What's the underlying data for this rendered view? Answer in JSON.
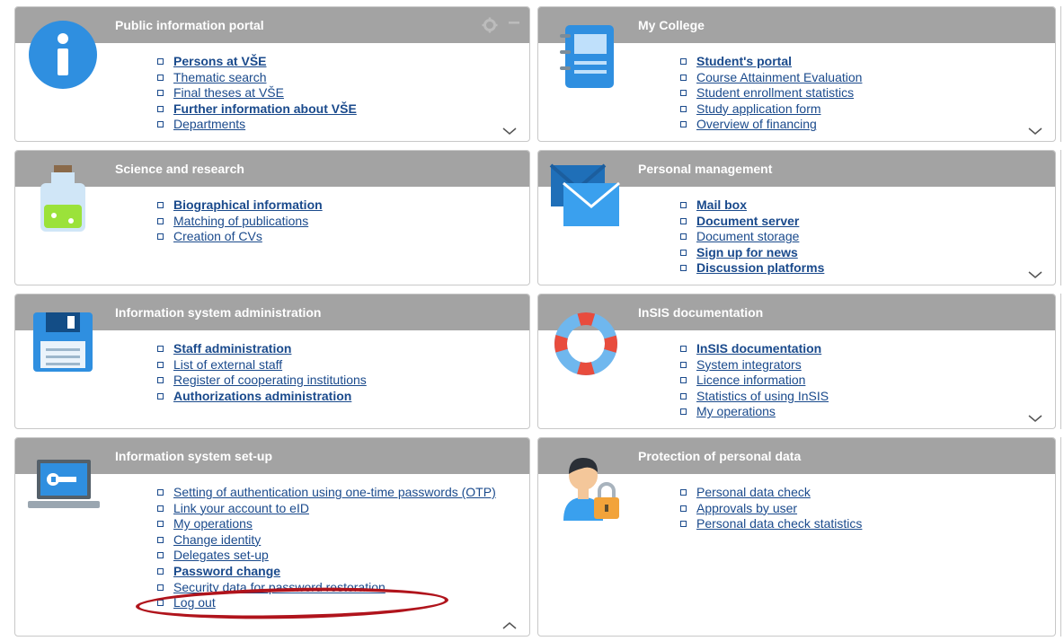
{
  "colors": {
    "header": "#a3a3a3",
    "link": "#1a4a8c",
    "highlight": "#b0141c"
  },
  "tiles": [
    {
      "title": "Public information portal",
      "icon": "info-icon",
      "toggle": "chevron-down-icon",
      "links": [
        {
          "label": "Persons at VŠE",
          "bold": true
        },
        {
          "label": "Thematic search",
          "bold": false
        },
        {
          "label": "Final theses at VŠE",
          "bold": false
        },
        {
          "label": "Further information about VŠE",
          "bold": true
        },
        {
          "label": "Departments",
          "bold": false
        }
      ]
    },
    {
      "title": "My College",
      "icon": "notebook-icon",
      "toggle": "chevron-down-icon",
      "links": [
        {
          "label": "Student's portal",
          "bold": true
        },
        {
          "label": "Course Attainment Evaluation",
          "bold": false
        },
        {
          "label": "Student enrollment statistics",
          "bold": false
        },
        {
          "label": "Study application form",
          "bold": false
        },
        {
          "label": "Overview of financing",
          "bold": false
        }
      ]
    },
    {
      "title": "Science and research",
      "icon": "flask-icon",
      "toggle": null,
      "links": [
        {
          "label": "Biographical information",
          "bold": true
        },
        {
          "label": "Matching of publications",
          "bold": false
        },
        {
          "label": "Creation of CVs",
          "bold": false
        }
      ]
    },
    {
      "title": "Personal management",
      "icon": "mail-icon",
      "toggle": "chevron-down-icon",
      "links": [
        {
          "label": "Mail box",
          "bold": true
        },
        {
          "label": "Document server",
          "bold": true
        },
        {
          "label": "Document storage",
          "bold": false
        },
        {
          "label": "Sign up for news",
          "bold": true
        },
        {
          "label": "Discussion platforms",
          "bold": true
        }
      ]
    },
    {
      "title": "Information system administration",
      "icon": "floppy-disk-icon",
      "toggle": null,
      "links": [
        {
          "label": "Staff administration",
          "bold": true
        },
        {
          "label": "List of external staff",
          "bold": false
        },
        {
          "label": "Register of cooperating institutions",
          "bold": false
        },
        {
          "label": "Authorizations administration",
          "bold": true
        }
      ]
    },
    {
      "title": "InSIS documentation",
      "icon": "lifebuoy-icon",
      "toggle": "chevron-down-icon",
      "links": [
        {
          "label": "InSIS documentation",
          "bold": true
        },
        {
          "label": "System integrators",
          "bold": false
        },
        {
          "label": "Licence information",
          "bold": false
        },
        {
          "label": "Statistics of using InSIS",
          "bold": false
        },
        {
          "label": "My operations",
          "bold": false
        }
      ]
    },
    {
      "title": "Information system set-up",
      "icon": "laptop-wrench-icon",
      "toggle": "chevron-up-icon",
      "links": [
        {
          "label": "Setting of authentication using one-time passwords (OTP)",
          "bold": false
        },
        {
          "label": "Link your account to eID",
          "bold": false
        },
        {
          "label": "My operations",
          "bold": false
        },
        {
          "label": "Change identity",
          "bold": false
        },
        {
          "label": "Delegates set-up",
          "bold": false
        },
        {
          "label": "Password change",
          "bold": true
        },
        {
          "label": "Security data for password restoration",
          "bold": false
        },
        {
          "label": "Log out",
          "bold": false
        }
      ]
    },
    {
      "title": "Protection of personal data",
      "icon": "user-lock-icon",
      "toggle": null,
      "links": [
        {
          "label": "Personal data check",
          "bold": false
        },
        {
          "label": "Approvals by user",
          "bold": false
        },
        {
          "label": "Personal data check statistics",
          "bold": false
        }
      ]
    }
  ]
}
